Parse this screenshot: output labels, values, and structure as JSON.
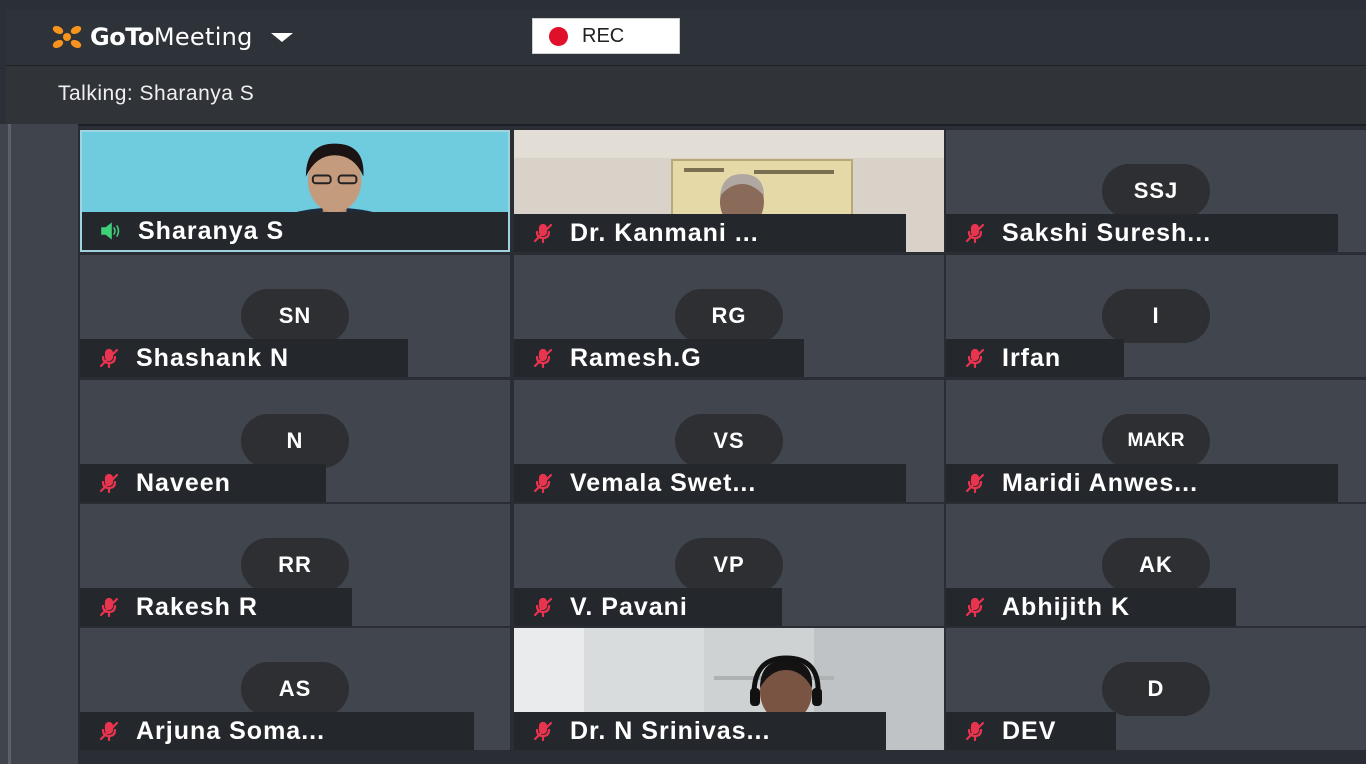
{
  "header": {
    "brand_bold": "GoTo",
    "brand_light": "Meeting",
    "rec_label": "REC",
    "colors": {
      "brand_orange": "#f7941d",
      "rec_red": "#e0102a"
    }
  },
  "status": {
    "talking_text": "Talking: Sharanya S"
  },
  "participants": [
    {
      "name": "Sharanya S",
      "initials": "",
      "video": true,
      "speaking": true,
      "muted": false
    },
    {
      "name": "Dr. Kanmani ...",
      "initials": "",
      "video": true,
      "speaking": false,
      "muted": true
    },
    {
      "name": "Sakshi Suresh...",
      "initials": "SSJ",
      "video": false,
      "speaking": false,
      "muted": true
    },
    {
      "name": "Shashank N",
      "initials": "SN",
      "video": false,
      "speaking": false,
      "muted": true
    },
    {
      "name": "Ramesh.G",
      "initials": "RG",
      "video": false,
      "speaking": false,
      "muted": true
    },
    {
      "name": "Irfan",
      "initials": "I",
      "video": false,
      "speaking": false,
      "muted": true
    },
    {
      "name": "Naveen",
      "initials": "N",
      "video": false,
      "speaking": false,
      "muted": true
    },
    {
      "name": "Vemala Swet...",
      "initials": "VS",
      "video": false,
      "speaking": false,
      "muted": true
    },
    {
      "name": "Maridi Anwes...",
      "initials": "MAKR",
      "video": false,
      "speaking": false,
      "muted": true
    },
    {
      "name": "Rakesh R",
      "initials": "RR",
      "video": false,
      "speaking": false,
      "muted": true
    },
    {
      "name": "V. Pavani",
      "initials": "VP",
      "video": false,
      "speaking": false,
      "muted": true
    },
    {
      "name": "Abhijith K",
      "initials": "AK",
      "video": false,
      "speaking": false,
      "muted": true
    },
    {
      "name": "Arjuna Soma...",
      "initials": "AS",
      "video": false,
      "speaking": false,
      "muted": true
    },
    {
      "name": "Dr. N Srinivas...",
      "initials": "",
      "video": true,
      "speaking": false,
      "muted": true
    },
    {
      "name": "DEV",
      "initials": "D",
      "video": false,
      "speaking": false,
      "muted": true
    }
  ],
  "icons": {
    "mic_muted": "mic-muted-icon",
    "speaker_active": "speaker-active-icon",
    "logo": "gotomeeting-logo-icon",
    "dropdown": "chevron-down-icon",
    "record": "record-dot-icon"
  }
}
